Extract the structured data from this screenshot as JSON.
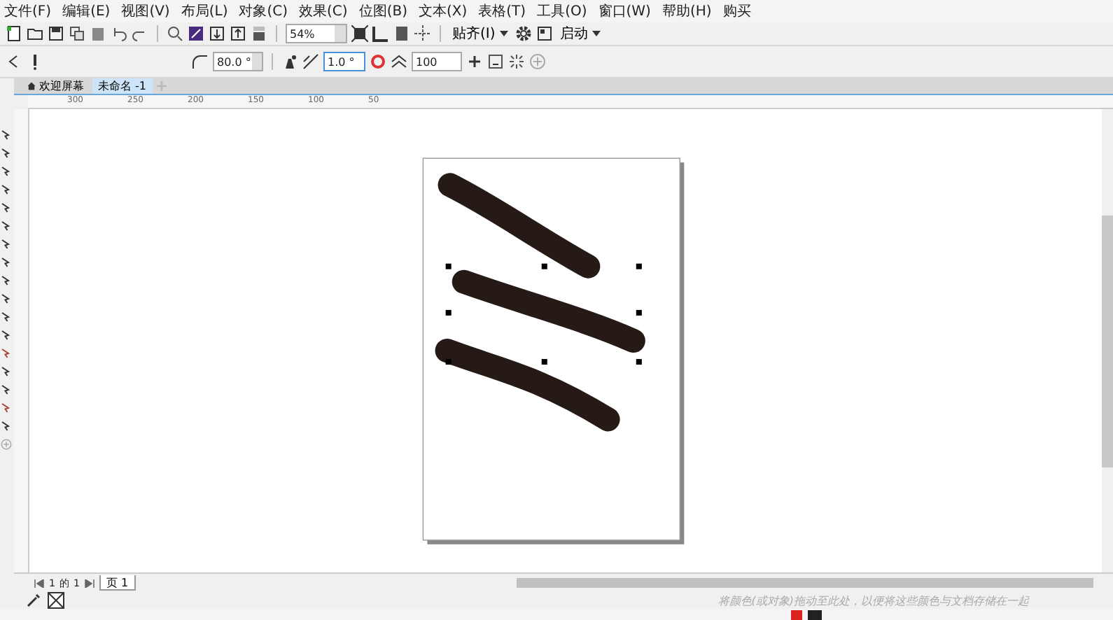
{
  "menu": [
    "文件(F)",
    "编辑(E)",
    "视图(V)",
    "布局(L)",
    "对象(C)",
    "效果(C)",
    "位图(B)",
    "文本(X)",
    "表格(T)",
    "工具(O)",
    "窗口(W)",
    "帮助(H)",
    "购买"
  ],
  "toolbar": {
    "zoom": "54%",
    "snap": "贴齐(I)",
    "launch": "启动"
  },
  "property_bar": {
    "angle": "80.0 °",
    "nib_angle": "1.0 °",
    "size": "100"
  },
  "tabs": [
    {
      "label": "欢迎屏幕",
      "selected": false,
      "home": true
    },
    {
      "label": "未命名 -1",
      "selected": true,
      "home": false
    }
  ],
  "ruler": [
    "300",
    "250",
    "200",
    "150",
    "100",
    "50"
  ],
  "page_nav": {
    "current": "1",
    "of": "的",
    "total": "1",
    "tab": "页 1"
  },
  "palette_hint": "将颜色(或对象)拖动至此处，以便将这些颜色与文档存储在一起"
}
